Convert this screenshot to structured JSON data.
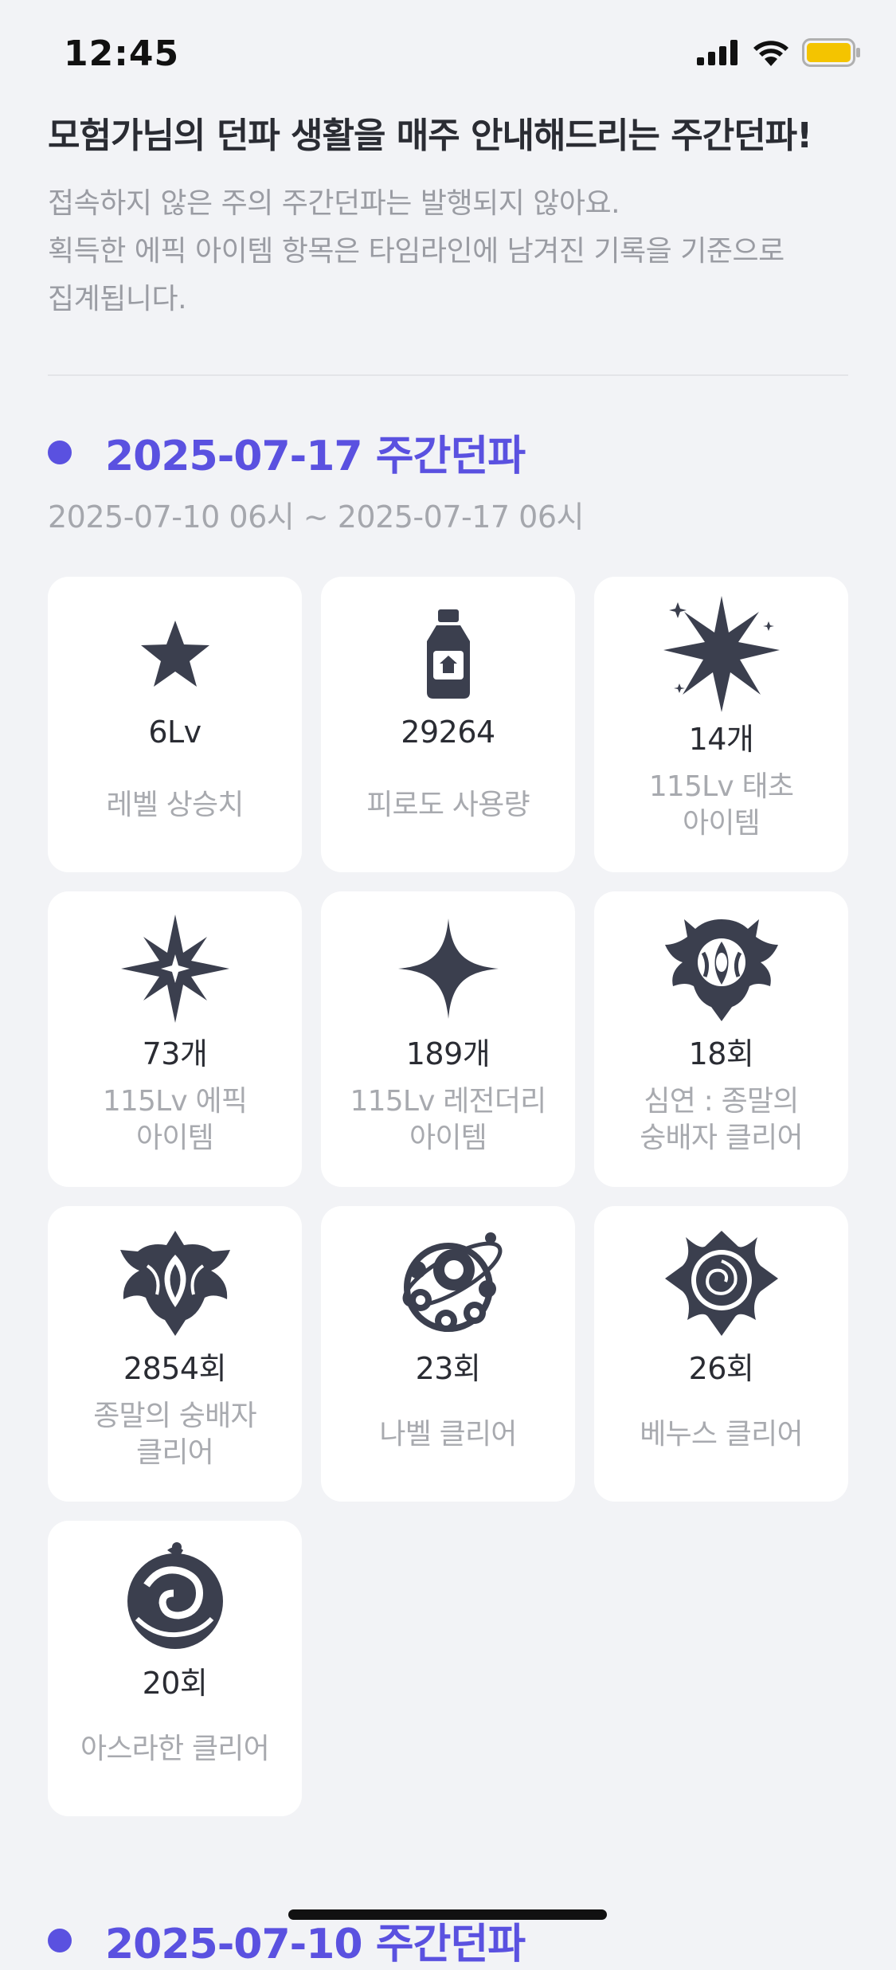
{
  "status_bar": {
    "time": "12:45"
  },
  "intro": {
    "title": "모험가님의 던파 생활을 매주 안내해드리는 주간던파!",
    "description_line1": "접속하지 않은 주의 주간던파는 발행되지 않아요.",
    "description_line2": "획득한 에픽 아이템 항목은 타임라인에 남겨진 기록을 기준으로",
    "description_line3": "집계됩니다."
  },
  "weeks": [
    {
      "title": "2025-07-17 주간던파",
      "range": "2025-07-10 06시 ~ 2025-07-17 06시",
      "cards": [
        {
          "icon": "star-icon",
          "value": "6Lv",
          "label": "레벨 상승치"
        },
        {
          "icon": "potion-bottle-icon",
          "value": "29264",
          "label": "피로도 사용량"
        },
        {
          "icon": "burst-star-icon",
          "value": "14개",
          "label": "115Lv 태초\n아이템"
        },
        {
          "icon": "epic-star-icon",
          "value": "73개",
          "label": "115Lv 에픽\n아이템"
        },
        {
          "icon": "sparkle-icon",
          "value": "189개",
          "label": "115Lv 레전더리\n아이템"
        },
        {
          "icon": "abyss-crest-icon",
          "value": "18회",
          "label": "심연 : 종말의\n숭배자 클리어"
        },
        {
          "icon": "worshipper-crest-icon",
          "value": "2854회",
          "label": "종말의 숭배자\n클리어"
        },
        {
          "icon": "nabel-orbit-icon",
          "value": "23회",
          "label": "나벨 클리어"
        },
        {
          "icon": "venus-rose-icon",
          "value": "26회",
          "label": "베누스 클리어"
        },
        {
          "icon": "ashraan-dragon-icon",
          "value": "20회",
          "label": "아스라한 클리어"
        }
      ]
    },
    {
      "title": "2025-07-10 주간던파"
    }
  ]
}
